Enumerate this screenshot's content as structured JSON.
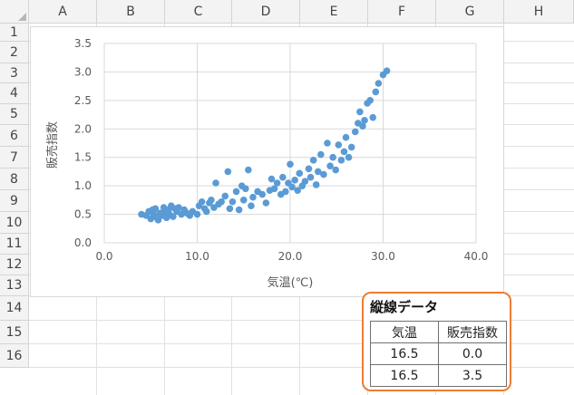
{
  "spreadsheet": {
    "columns": [
      "A",
      "B",
      "C",
      "D",
      "E",
      "F",
      "G",
      "H"
    ],
    "rows": [
      "1",
      "2",
      "3",
      "4",
      "5",
      "6",
      "7",
      "8",
      "9",
      "10",
      "11",
      "12",
      "13",
      "14",
      "15",
      "16"
    ]
  },
  "chart_data": {
    "type": "scatter",
    "xlabel": "気温(℃)",
    "ylabel": "販売指数",
    "xlim": [
      0,
      40
    ],
    "ylim": [
      0,
      3.5
    ],
    "x_ticks": [
      "0.0",
      "10.0",
      "20.0",
      "30.0",
      "40.0"
    ],
    "y_ticks": [
      "0.0",
      "0.5",
      "1.0",
      "1.5",
      "2.0",
      "2.5",
      "3.0",
      "3.5"
    ],
    "grid": true,
    "color": "#5b9bd5",
    "points": [
      [
        4.0,
        0.5
      ],
      [
        4.5,
        0.48
      ],
      [
        4.8,
        0.55
      ],
      [
        5.0,
        0.42
      ],
      [
        5.2,
        0.58
      ],
      [
        5.3,
        0.5
      ],
      [
        5.5,
        0.6
      ],
      [
        5.6,
        0.45
      ],
      [
        5.8,
        0.4
      ],
      [
        6.0,
        0.52
      ],
      [
        6.2,
        0.48
      ],
      [
        6.4,
        0.62
      ],
      [
        6.5,
        0.55
      ],
      [
        6.7,
        0.44
      ],
      [
        6.9,
        0.58
      ],
      [
        7.0,
        0.5
      ],
      [
        7.2,
        0.65
      ],
      [
        7.4,
        0.46
      ],
      [
        7.6,
        0.6
      ],
      [
        7.8,
        0.55
      ],
      [
        8.0,
        0.62
      ],
      [
        8.3,
        0.5
      ],
      [
        8.6,
        0.58
      ],
      [
        8.9,
        0.52
      ],
      [
        9.2,
        0.48
      ],
      [
        9.5,
        0.55
      ],
      [
        10.0,
        0.5
      ],
      [
        10.2,
        0.65
      ],
      [
        10.5,
        0.72
      ],
      [
        10.8,
        0.6
      ],
      [
        11.0,
        0.55
      ],
      [
        11.3,
        0.7
      ],
      [
        11.5,
        0.75
      ],
      [
        11.8,
        0.62
      ],
      [
        12.0,
        1.05
      ],
      [
        12.3,
        0.68
      ],
      [
        12.6,
        0.72
      ],
      [
        13.0,
        0.82
      ],
      [
        13.3,
        1.25
      ],
      [
        13.5,
        0.6
      ],
      [
        13.8,
        0.72
      ],
      [
        14.2,
        0.9
      ],
      [
        14.5,
        0.58
      ],
      [
        14.8,
        1.0
      ],
      [
        15.0,
        0.75
      ],
      [
        15.2,
        0.95
      ],
      [
        15.5,
        1.28
      ],
      [
        15.8,
        0.65
      ],
      [
        16.0,
        0.8
      ],
      [
        16.5,
        0.9
      ],
      [
        17.0,
        0.85
      ],
      [
        17.4,
        0.7
      ],
      [
        17.8,
        0.92
      ],
      [
        18.0,
        1.12
      ],
      [
        18.3,
        0.95
      ],
      [
        18.6,
        1.05
      ],
      [
        19.0,
        0.85
      ],
      [
        19.2,
        1.15
      ],
      [
        19.5,
        0.9
      ],
      [
        19.8,
        1.05
      ],
      [
        20.0,
        1.38
      ],
      [
        20.2,
        0.98
      ],
      [
        20.5,
        1.1
      ],
      [
        20.8,
        0.92
      ],
      [
        21.0,
        1.22
      ],
      [
        21.3,
        1.0
      ],
      [
        21.6,
        1.08
      ],
      [
        22.0,
        1.3
      ],
      [
        22.2,
        1.15
      ],
      [
        22.5,
        1.45
      ],
      [
        22.8,
        1.02
      ],
      [
        23.0,
        1.25
      ],
      [
        23.3,
        1.55
      ],
      [
        23.6,
        1.2
      ],
      [
        24.0,
        1.75
      ],
      [
        24.3,
        1.35
      ],
      [
        24.6,
        1.5
      ],
      [
        24.9,
        1.28
      ],
      [
        25.2,
        1.72
      ],
      [
        25.5,
        1.45
      ],
      [
        25.8,
        1.6
      ],
      [
        26.0,
        1.85
      ],
      [
        26.3,
        1.5
      ],
      [
        26.6,
        1.68
      ],
      [
        27.0,
        1.95
      ],
      [
        27.3,
        2.1
      ],
      [
        27.5,
        2.3
      ],
      [
        27.8,
        2.05
      ],
      [
        28.0,
        2.15
      ],
      [
        28.3,
        2.45
      ],
      [
        28.6,
        2.5
      ],
      [
        28.9,
        2.2
      ],
      [
        29.2,
        2.65
      ],
      [
        29.5,
        2.8
      ],
      [
        30.0,
        2.95
      ],
      [
        30.4,
        3.02
      ]
    ]
  },
  "table_box": {
    "title": "縦線データ",
    "headers": [
      "気温",
      "販売指数"
    ],
    "rows": [
      [
        "16.5",
        "0.0"
      ],
      [
        "16.5",
        "3.5"
      ]
    ]
  }
}
